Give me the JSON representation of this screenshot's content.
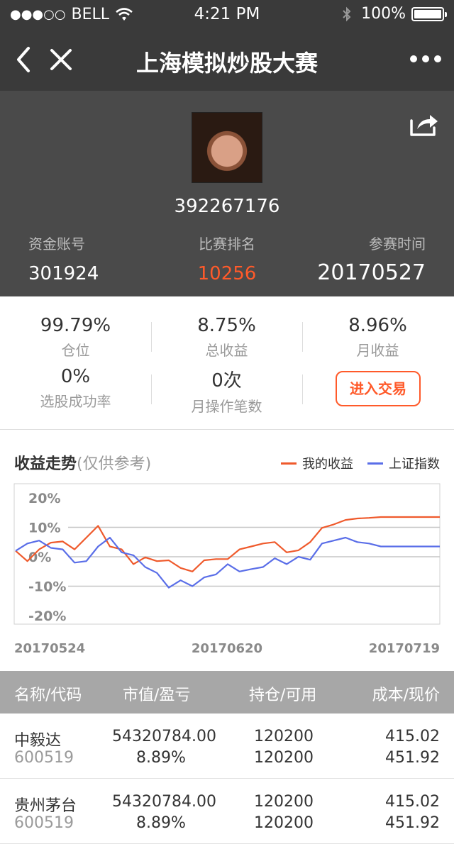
{
  "status_bar": {
    "signal": "●●●○○",
    "carrier": "BELL",
    "time": "4:21 PM",
    "battery": "100%"
  },
  "nav": {
    "title": "上海模拟炒股大赛"
  },
  "profile": {
    "user_id": "392267176",
    "account_label": "资金账号",
    "account_value": "301924",
    "rank_label": "比赛排名",
    "rank_value": "10256",
    "join_label": "参赛时间",
    "join_value": "20170527"
  },
  "metrics": {
    "position_value": "99.79%",
    "position_label": "仓位",
    "total_return_value": "8.75%",
    "total_return_label": "总收益",
    "monthly_return_value": "8.96%",
    "monthly_return_label": "月收益",
    "success_rate_value": "0%",
    "success_rate_label": "选股成功率",
    "monthly_ops_value": "0次",
    "monthly_ops_label": "月操作笔数",
    "trade_button": "进入交易"
  },
  "chart_section": {
    "title": "收益走势",
    "subtitle": "(仅供参考)"
  },
  "chart_data": {
    "type": "line",
    "x_labels": [
      "20170524",
      "20170620",
      "20170719"
    ],
    "y_ticks": [
      "20%",
      "10%",
      "0%",
      "-10%",
      "-20%"
    ],
    "ylim": [
      -20,
      20
    ],
    "grid": true,
    "legend_position": "top-right",
    "x": [
      "20170524",
      "20170526",
      "20170529",
      "20170531",
      "20170602",
      "20170605",
      "20170607",
      "20170609",
      "20170612",
      "20170613",
      "20170614",
      "20170615",
      "20170616",
      "20170619",
      "20170620",
      "20170621",
      "20170622",
      "20170623",
      "20170626",
      "20170627",
      "20170628",
      "20170629",
      "20170630",
      "20170703",
      "20170704",
      "20170705",
      "20170706",
      "20170707",
      "20170710",
      "20170711",
      "20170712",
      "20170713",
      "20170714",
      "20170717",
      "20170718",
      "20170719",
      "20170720"
    ],
    "series": [
      {
        "name": "我的收益",
        "color": "#ef5a2c",
        "values": [
          2,
          -1.5,
          2.5,
          4.8,
          5.2,
          2.5,
          6.5,
          10.5,
          3.5,
          2.5,
          -2.5,
          -0.2,
          -1.5,
          -1.2,
          -3.8,
          -5,
          -1.2,
          -0.8,
          -0.8,
          2.5,
          3.5,
          4.5,
          5,
          1.5,
          2.2,
          5,
          9.8,
          11,
          12.5,
          13,
          13.2,
          13.5,
          13.5,
          13.5,
          13.5,
          13.5,
          13.5
        ]
      },
      {
        "name": "上证指数",
        "color": "#5a6ee8",
        "values": [
          2,
          4.5,
          5.5,
          3,
          2.5,
          -2,
          -1.5,
          3.5,
          6.5,
          1.5,
          0.5,
          -3.5,
          -5.5,
          -10.5,
          -8,
          -10,
          -7,
          -6,
          -2.5,
          -5,
          -4.2,
          -3.5,
          -0.5,
          -2.5,
          0,
          -1,
          4.5,
          5.5,
          6.5,
          5,
          4.5,
          3.5,
          3.5,
          3.5,
          3.5,
          3.5,
          3.5
        ]
      }
    ]
  },
  "table": {
    "headers": [
      "名称/代码",
      "市值/盈亏",
      "持仓/可用",
      "成本/现价"
    ],
    "rows": [
      {
        "name": "中毅达",
        "code": "600519",
        "market_value": "54320784.00",
        "pnl": "8.89%",
        "holding": "120200",
        "available": "120200",
        "cost": "415.02",
        "price": "451.92"
      },
      {
        "name": "贵州茅台",
        "code": "600519",
        "market_value": "54320784.00",
        "pnl": "8.89%",
        "holding": "120200",
        "available": "120200",
        "cost": "415.02",
        "price": "451.92"
      }
    ]
  }
}
